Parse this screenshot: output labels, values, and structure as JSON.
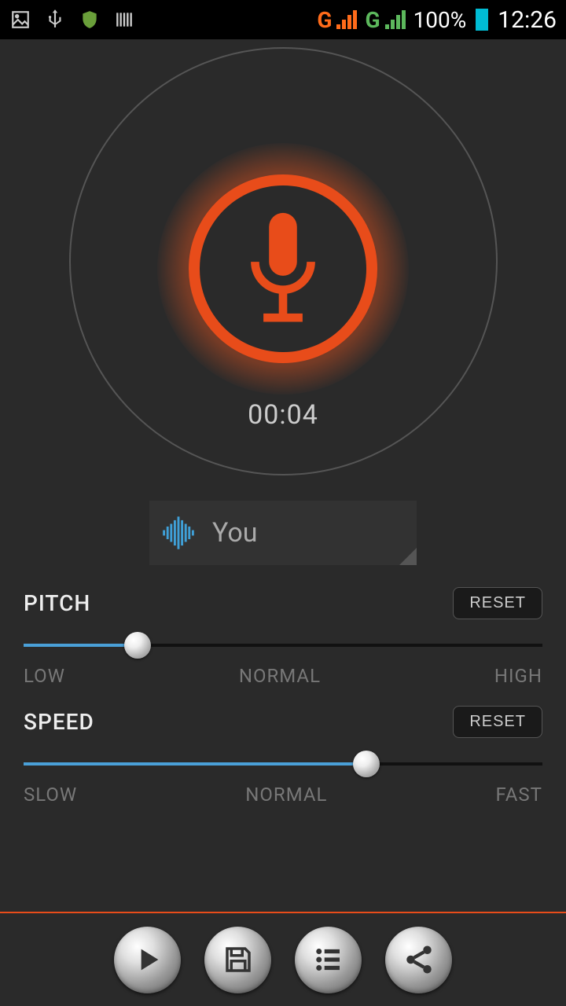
{
  "status": {
    "battery_pct": "100%",
    "time": "12:26",
    "network1_g": "G",
    "network2_g": "G"
  },
  "recorder": {
    "timer": "00:04",
    "preset_label": "You"
  },
  "pitch": {
    "title": "PITCH",
    "reset": "RESET",
    "low": "LOW",
    "normal": "NORMAL",
    "high": "HIGH",
    "value_pct": 22
  },
  "speed": {
    "title": "SPEED",
    "reset": "RESET",
    "slow": "SLOW",
    "normal": "NORMAL",
    "fast": "FAST",
    "value_pct": 66
  },
  "colors": {
    "accent": "#e84c1a",
    "slider_fill": "#4aa0d8"
  }
}
